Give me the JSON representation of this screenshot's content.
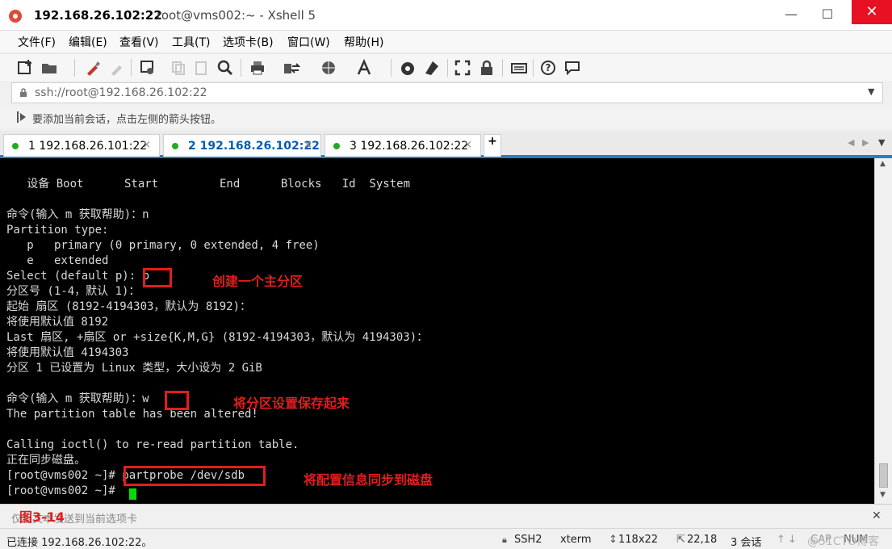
{
  "window": {
    "title_host": "192.168.26.102:22",
    "title_rest": "root@vms002:~ - Xshell 5",
    "minimize": "—",
    "maximize": "☐",
    "close": "✕"
  },
  "menu": [
    "文件(F)",
    "编辑(E)",
    "查看(V)",
    "工具(T)",
    "选项卡(B)",
    "窗口(W)",
    "帮助(H)"
  ],
  "address": "ssh://root@192.168.26.102:22",
  "hint": "要添加当前会话，点击左侧的箭头按钮。",
  "tabs": [
    {
      "label": "1 192.168.26.101:22"
    },
    {
      "label": "2 192.168.26.102:22"
    },
    {
      "label": "3 192.168.26.102:22"
    }
  ],
  "tab_add": "+",
  "terminal": {
    "lines": [
      "   设备 Boot      Start         End      Blocks   Id  System",
      "",
      "命令(输入 m 获取帮助)：n",
      "Partition type:",
      "   p   primary (0 primary, 0 extended, 4 free)",
      "   e   extended",
      "Select (default p): p",
      "分区号 (1-4，默认 1)：",
      "起始 扇区 (8192-4194303，默认为 8192)：",
      "将使用默认值 8192",
      "Last 扇区, +扇区 or +size{K,M,G} (8192-4194303，默认为 4194303)：",
      "将使用默认值 4194303",
      "分区 1 已设置为 Linux 类型，大小设为 2 GiB",
      "",
      "命令(输入 m 获取帮助)：w",
      "The partition table has been altered!",
      "",
      "Calling ioctl() to re-read partition table.",
      "正在同步磁盘。",
      "[root@vms002 ~]# partprobe /dev/sdb",
      "[root@vms002 ~]# "
    ]
  },
  "annotations": {
    "create_primary": "创建一个主分区",
    "save_partition": "将分区设置保存起来",
    "sync_disk": "将配置信息同步到磁盘"
  },
  "compose_placeholder": "仅将文本发送到当前选项卡",
  "figure_caption": "图3-14",
  "status": {
    "connected": "已连接 192.168.26.102:22。",
    "protocol": "SSH2",
    "term": "xterm",
    "size": "118x22",
    "cursor_pos": "22,18",
    "sessions": "3 会话",
    "caps": "CAP",
    "num": "NUM"
  },
  "watermark": "@51CTO博客",
  "colors": {
    "accent": "#2b7bbf",
    "annotation": "#e21d1d",
    "terminal_bg": "#000000",
    "terminal_fg": "#d9d9d9",
    "cursor": "#00e000",
    "close_button": "#e81123"
  }
}
